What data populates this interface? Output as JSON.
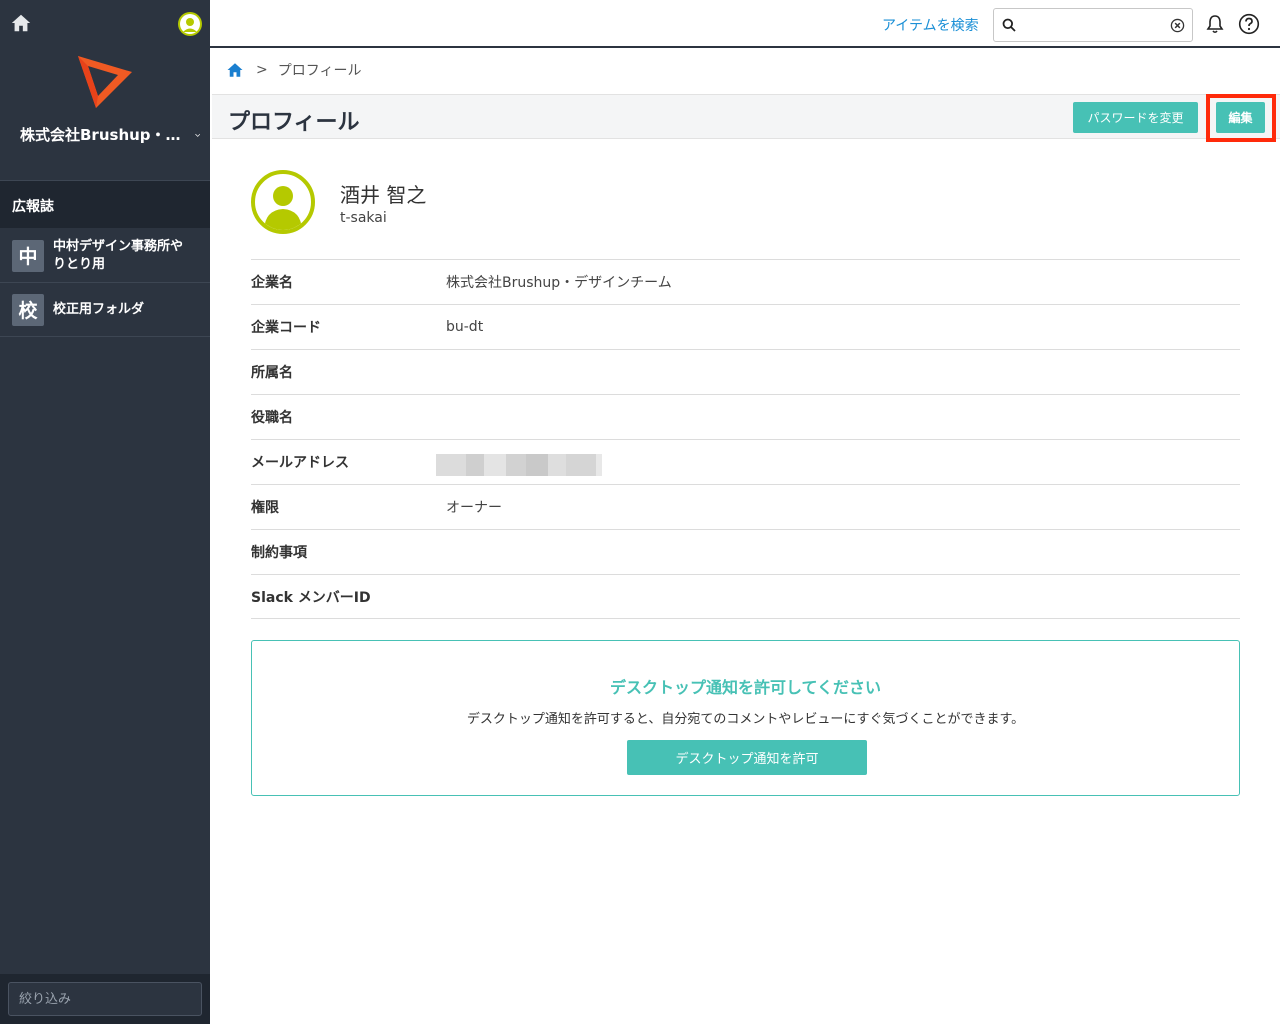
{
  "sidebar": {
    "org_name": "株式会社Brushup・…",
    "section_title": "広報誌",
    "folders": [
      {
        "badge": "中",
        "label_line1": "中村デザイン事務所や",
        "label_line2": "りとり用"
      },
      {
        "badge": "校",
        "label_line1": "校正用フォルダ",
        "label_line2": ""
      }
    ],
    "filter_placeholder": "絞り込み"
  },
  "topbar": {
    "search_label": "アイテムを検索",
    "search_value": ""
  },
  "breadcrumb": {
    "current": "プロフィール",
    "separator": ">"
  },
  "page": {
    "title": "プロフィール",
    "change_password_button": "パスワードを変更",
    "edit_button": "編集"
  },
  "profile": {
    "name": "酒井 智之",
    "user_id": "t-sakai",
    "fields": [
      {
        "key": "企業名",
        "value": "株式会社Brushup・デザインチーム"
      },
      {
        "key": "企業コード",
        "value": "bu-dt"
      },
      {
        "key": "所属名",
        "value": ""
      },
      {
        "key": "役職名",
        "value": ""
      },
      {
        "key": "メールアドレス",
        "value": ""
      },
      {
        "key": "権限",
        "value": "オーナー"
      },
      {
        "key": "制約事項",
        "value": ""
      },
      {
        "key": "Slack メンバーID",
        "value": ""
      }
    ]
  },
  "notification": {
    "title": "デスクトップ通知を許可してください",
    "text": "デスクトップ通知を許可すると、自分宛てのコメントやレビューにすぐ気づくことができます。",
    "button": "デスクトップ通知を許可"
  },
  "colors": {
    "sidebar_bg": "#2c3440",
    "accent": "#47c1b5",
    "link": "#1a8fd6",
    "highlight": "#ff2a0a",
    "avatar": "#b5c900"
  }
}
